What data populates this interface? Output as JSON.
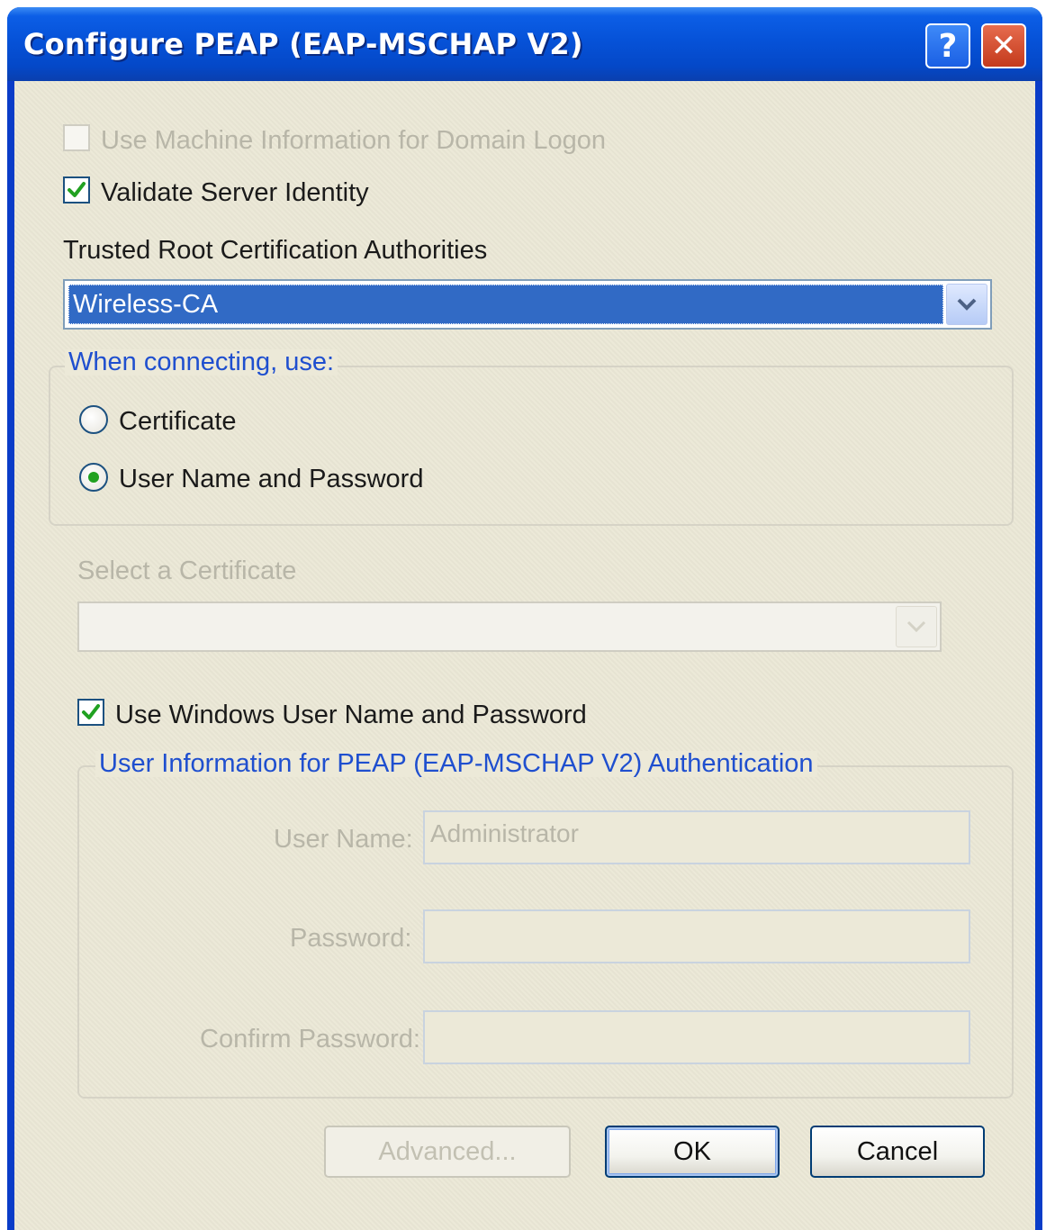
{
  "window": {
    "title": "Configure PEAP (EAP-MSCHAP V2)",
    "help_glyph": "?",
    "close_glyph": "✕"
  },
  "options": {
    "use_machine_info": {
      "label": "Use Machine Information for Domain Logon",
      "checked": false,
      "enabled": false
    },
    "validate_server": {
      "label": "Validate Server Identity",
      "checked": true
    }
  },
  "trusted_root": {
    "label": "Trusted Root Certification Authorities",
    "selected": "Wireless-CA"
  },
  "when_connecting": {
    "legend": "When connecting, use:",
    "certificate_label": "Certificate",
    "username_password_label": "User Name and Password",
    "selected": "User Name and Password"
  },
  "select_certificate": {
    "label": "Select a Certificate",
    "value": ""
  },
  "use_windows_credentials": {
    "label": "Use Windows User Name and Password",
    "checked": true
  },
  "user_info": {
    "legend": "User Information for PEAP (EAP-MSCHAP V2) Authentication",
    "username_label": "User Name:",
    "username_value": "Administrator",
    "password_label": "Password:",
    "password_value": "",
    "confirm_label": "Confirm Password:",
    "confirm_value": ""
  },
  "buttons": {
    "advanced": "Advanced...",
    "ok": "OK",
    "cancel": "Cancel"
  },
  "colors": {
    "titlebar": "#0652d8",
    "dialog_background": "#ece9d8",
    "selection": "#316ac5",
    "group_legend": "#1f4fcf",
    "checkmark": "#21a121"
  },
  "icons": {
    "check": "check-icon",
    "dropdown": "chevron-down-icon",
    "help": "help-icon",
    "close": "close-icon"
  }
}
